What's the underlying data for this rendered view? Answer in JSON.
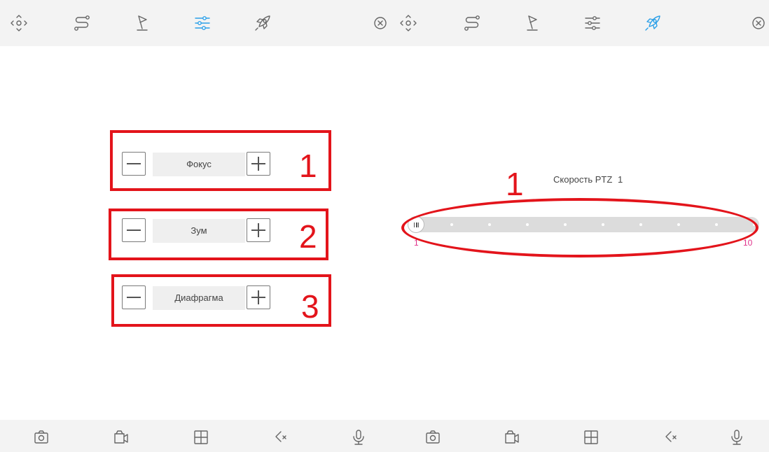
{
  "left_panel": {
    "toolbar": {
      "icons": [
        "ptz-direction-icon",
        "route-icon",
        "preset-flag-icon",
        "lens-settings-icon",
        "speed-rocket-icon",
        "close-icon"
      ],
      "active": "lens-settings-icon"
    },
    "controls": [
      {
        "label": "Фокус",
        "annotation": "1"
      },
      {
        "label": "Зум",
        "annotation": "2"
      },
      {
        "label": "Диафрагма",
        "annotation": "3"
      }
    ]
  },
  "right_panel": {
    "toolbar": {
      "icons": [
        "ptz-direction-icon",
        "route-icon",
        "preset-flag-icon",
        "lens-settings-icon",
        "speed-rocket-icon",
        "close-icon"
      ],
      "active": "speed-rocket-icon"
    },
    "speed": {
      "label": "Скорость PTZ",
      "value": "1",
      "min": "1",
      "max": "10",
      "annotation": "1"
    }
  },
  "bottom_toolbar": {
    "icons": [
      "camera-icon",
      "video-record-icon",
      "grid-layout-icon",
      "mute-icon",
      "microphone-icon"
    ]
  },
  "colors": {
    "accent": "#2a9fe8",
    "annotation_red": "#e3141b",
    "scale_pink": "#e0318a"
  }
}
